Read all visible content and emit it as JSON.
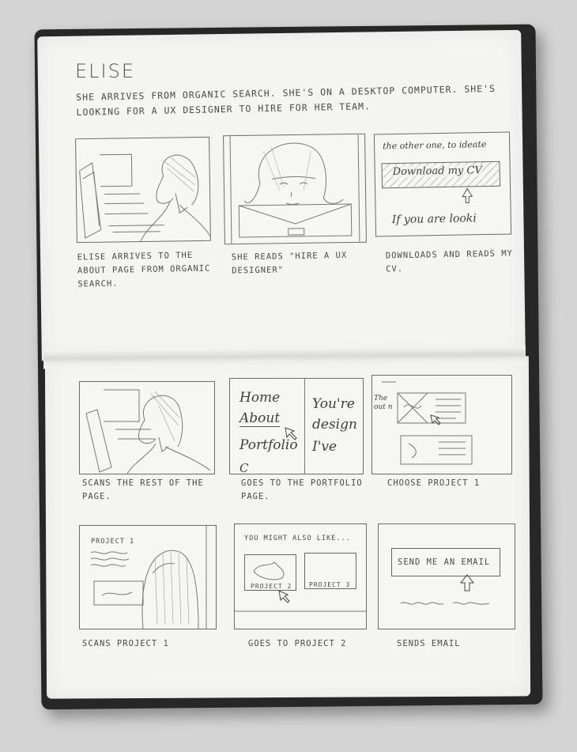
{
  "title": "ELISE",
  "intro": "SHE ARRIVES FROM ORGANIC SEARCH. SHE'S ON A DESKTOP COMPUTER. SHE'S LOOKING FOR A UX DESIGNER TO HIRE FOR HER TEAM.",
  "panels": [
    {
      "caption": "ELISE ARRIVES TO THE ABOUT PAGE FROM ORGANIC SEARCH."
    },
    {
      "caption": "SHE READS \"HIRE A UX DESIGNER\""
    },
    {
      "caption": "DOWNLOADS AND READS MY CV.",
      "texts": {
        "line1": "the other one, to ideate",
        "button": "Download my CV",
        "line2": "If you are looki"
      }
    },
    {
      "caption": "SCANS THE REST OF THE PAGE."
    },
    {
      "caption": "GOES TO THE PORTFOLIO PAGE.",
      "texts": {
        "nav1": "Home",
        "nav2": "About",
        "nav3": "Portfolio",
        "nav4": "C",
        "body1": "You're",
        "body2": "design",
        "body3": "I've"
      }
    },
    {
      "caption": "CHOOSE PROJECT 1",
      "texts": {
        "side": "The out n"
      }
    },
    {
      "caption": "SCANS PROJECT 1",
      "texts": {
        "heading": "PROJECT 1"
      }
    },
    {
      "caption": "GOES TO PROJECT 2",
      "texts": {
        "heading": "YOU MIGHT ALSO LIKE...",
        "card1": "PROJECT 2",
        "card2": "PROJECT 3"
      }
    },
    {
      "caption": "SENDS EMAIL",
      "texts": {
        "button": "SEND ME AN EMAIL"
      }
    }
  ]
}
